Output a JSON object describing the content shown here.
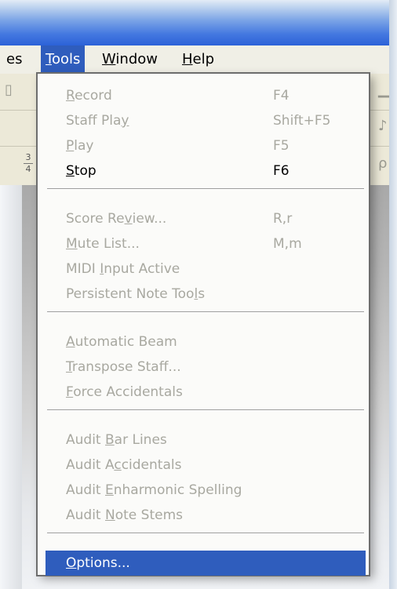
{
  "menubar": {
    "items": [
      {
        "label": "es",
        "ul_index": -1
      },
      {
        "label": "Tools",
        "ul_index": 0
      },
      {
        "label": "Window",
        "ul_index": 0
      },
      {
        "label": "Help",
        "ul_index": 0
      }
    ]
  },
  "tools_menu": {
    "groups": [
      [
        {
          "label": "Record",
          "ul_index": 0,
          "shortcut": "F4",
          "enabled": false
        },
        {
          "label": "Staff Play",
          "ul_index": 9,
          "shortcut": "Shift+F5",
          "enabled": false
        },
        {
          "label": "Play",
          "ul_index": 0,
          "shortcut": "F5",
          "enabled": false
        },
        {
          "label": "Stop",
          "ul_index": 0,
          "shortcut": "F6",
          "enabled": true
        }
      ],
      [
        {
          "label": "Score Review...",
          "ul_index": 8,
          "shortcut": "R,r",
          "enabled": false
        },
        {
          "label": "Mute List...",
          "ul_index": 0,
          "shortcut": "M,m",
          "enabled": false
        },
        {
          "label": "MIDI Input Active",
          "ul_index": 5,
          "shortcut": "",
          "enabled": false
        },
        {
          "label": "Persistent Note Tools",
          "ul_index": 19,
          "shortcut": "",
          "enabled": false
        }
      ],
      [
        {
          "label": "Automatic Beam",
          "ul_index": 0,
          "shortcut": "",
          "enabled": false
        },
        {
          "label": "Transpose Staff...",
          "ul_index": 0,
          "shortcut": "",
          "enabled": false
        },
        {
          "label": "Force Accidentals",
          "ul_index": 0,
          "shortcut": "",
          "enabled": false
        }
      ],
      [
        {
          "label": "Audit Bar Lines",
          "ul_index": 6,
          "shortcut": "",
          "enabled": false
        },
        {
          "label": "Audit Accidentals",
          "ul_index": 7,
          "shortcut": "",
          "enabled": false
        },
        {
          "label": "Audit Enharmonic Spelling",
          "ul_index": 6,
          "shortcut": "",
          "enabled": false
        },
        {
          "label": "Audit Note Stems",
          "ul_index": 6,
          "shortcut": "",
          "enabled": false
        }
      ],
      [
        {
          "label": "Options...",
          "ul_index": 0,
          "shortcut": "",
          "enabled": true,
          "selected": true
        }
      ]
    ]
  },
  "toolbar": {
    "time_sig_top": "3",
    "time_sig_bottom": "4"
  },
  "colors": {
    "menu_highlight": "#2f5dbd",
    "disabled_text": "#a8a8a0",
    "title_blue": "#2c62d8"
  }
}
